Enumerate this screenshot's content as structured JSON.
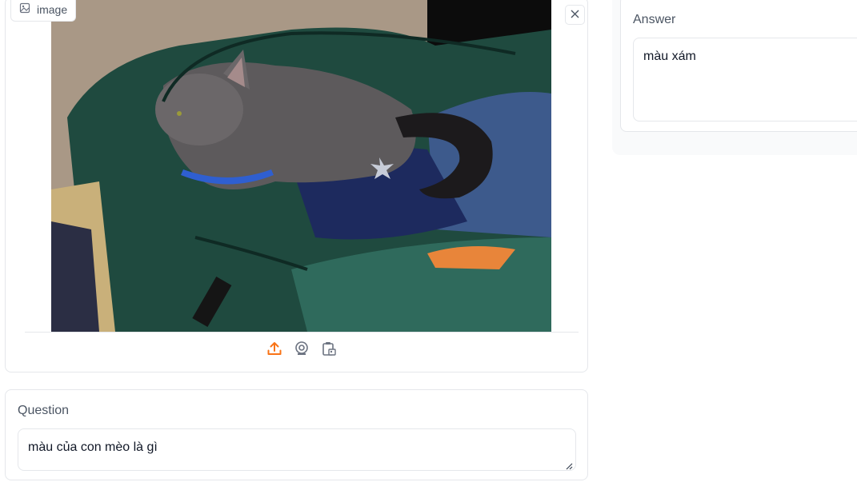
{
  "image_panel": {
    "label": "image",
    "icons": {
      "label_icon": "image-icon",
      "close": "close-icon",
      "upload": "upload-icon",
      "webcam": "webcam-icon",
      "clipboard": "clipboard-icon"
    }
  },
  "question": {
    "label": "Question",
    "value": "màu của con mèo là gì"
  },
  "answer": {
    "label": "Answer",
    "value": "màu xám"
  },
  "colors": {
    "accent": "#f97316",
    "border": "#e5e7eb",
    "label_text": "#4b5563"
  }
}
